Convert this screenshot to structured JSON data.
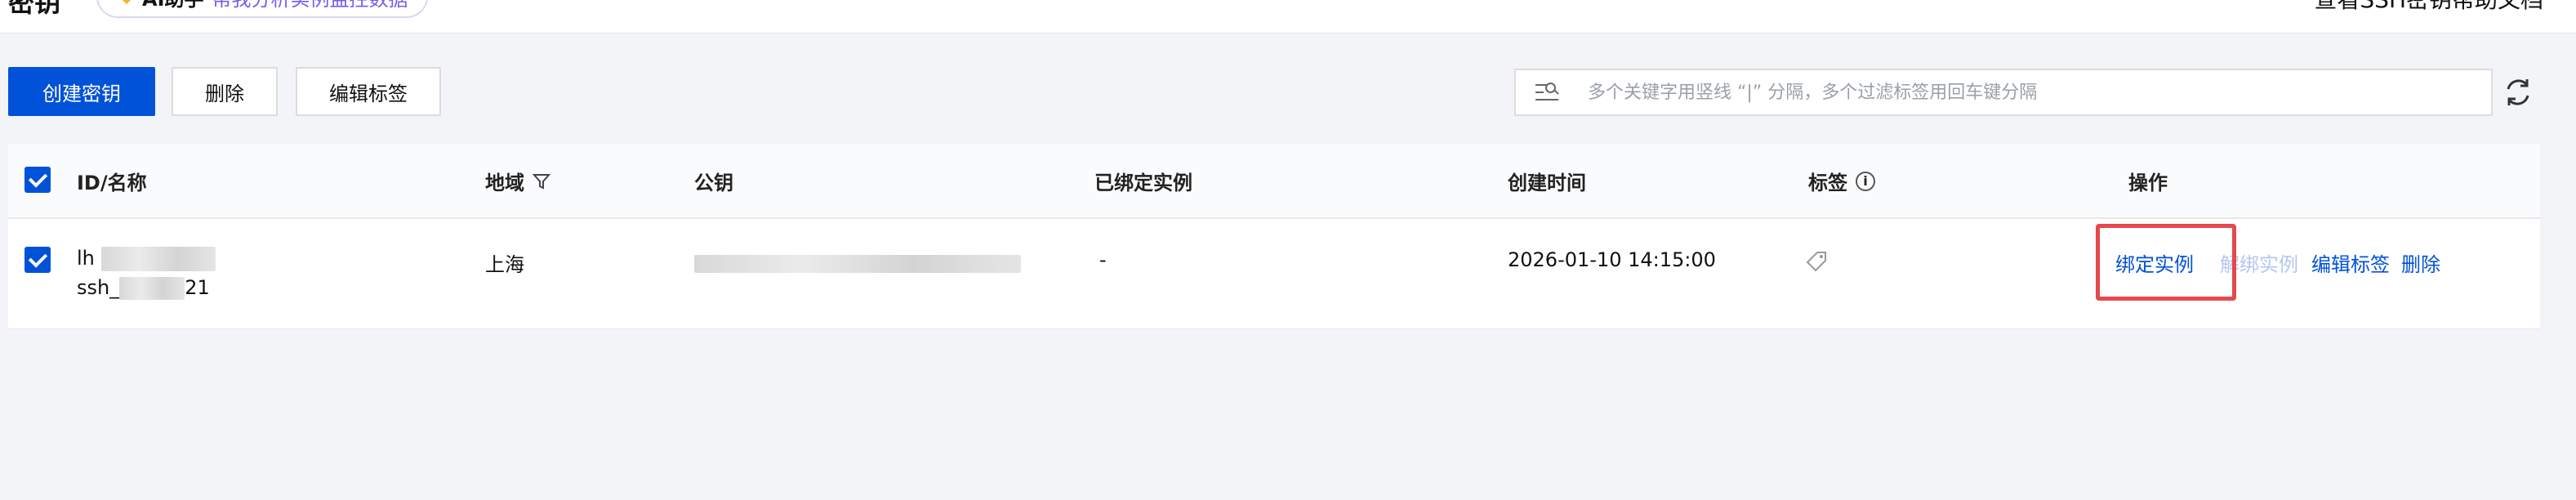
{
  "header": {
    "title": "密钥",
    "ai_assistant": {
      "name": "AI助手",
      "description": "帮我分析实例监控数据"
    },
    "help_link": "查看SSH密钥帮助文档"
  },
  "toolbar": {
    "create_label": "创建密钥",
    "delete_label": "删除",
    "edit_tags_label": "编辑标签",
    "search_placeholder": "多个关键字用竖线 “|” 分隔，多个过滤标签用回车键分隔"
  },
  "table": {
    "columns": {
      "id_name": "ID/名称",
      "region": "地域",
      "public_key": "公钥",
      "bound_instances": "已绑定实例",
      "created_time": "创建时间",
      "tags": "标签",
      "actions": "操作"
    },
    "rows": [
      {
        "id_visible": "lh",
        "name_prefix": "ssh_",
        "name_suffix": "21",
        "region": "上海",
        "bound_instances": "-",
        "created_time": "2026-01-10 14:15:00",
        "actions": {
          "bind": "绑定实例",
          "unbind": "解绑实例",
          "edit_tags": "编辑标签",
          "delete": "删除"
        }
      }
    ]
  },
  "colors": {
    "primary": "#0052d9",
    "highlight": "#e5484d"
  }
}
